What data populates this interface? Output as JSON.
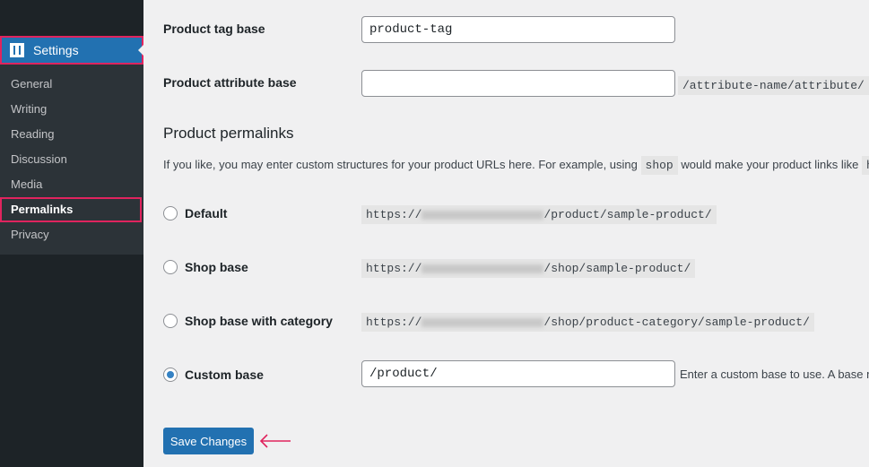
{
  "sidebar": {
    "settings_label": "Settings",
    "items": [
      {
        "label": "General"
      },
      {
        "label": "Writing"
      },
      {
        "label": "Reading"
      },
      {
        "label": "Discussion"
      },
      {
        "label": "Media"
      },
      {
        "label": "Permalinks",
        "active": true
      },
      {
        "label": "Privacy"
      }
    ]
  },
  "fields": {
    "tag_base_label": "Product tag base",
    "tag_base_value": "product-tag",
    "attr_base_label": "Product attribute base",
    "attr_base_value": "",
    "attr_base_hint": "/attribute-name/attribute/"
  },
  "permalinks": {
    "heading": "Product permalinks",
    "desc_before": "If you like, you may enter custom structures for your product URLs here. For example, using",
    "desc_code": "shop",
    "desc_after": "would make your product links like",
    "desc_trail": "h",
    "options": [
      {
        "label": "Default",
        "prefix": "https://",
        "suffix": "/product/sample-product/",
        "selected": false
      },
      {
        "label": "Shop base",
        "prefix": "https://",
        "suffix": "/shop/sample-product/",
        "selected": false
      },
      {
        "label": "Shop base with category",
        "prefix": "https://",
        "suffix": "/shop/product-category/sample-product/",
        "selected": false
      }
    ],
    "custom": {
      "label": "Custom base",
      "value": "/product/",
      "hint": "Enter a custom base to use. A base m",
      "selected": true
    }
  },
  "save_label": "Save Changes",
  "colors": {
    "accent": "#2271b1",
    "highlight": "#e0245e"
  }
}
